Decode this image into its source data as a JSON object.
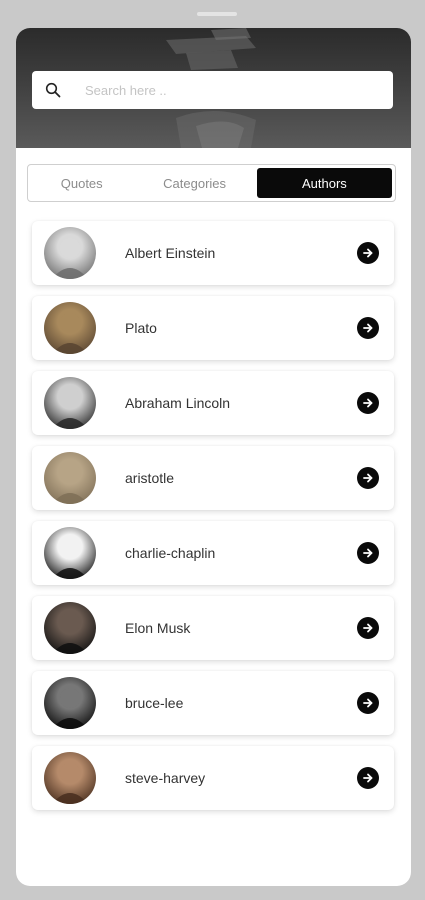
{
  "search": {
    "placeholder": "Search here ..",
    "icon": "search-icon"
  },
  "tabs": [
    {
      "label": "Quotes",
      "active": false
    },
    {
      "label": "Categories",
      "active": false
    },
    {
      "label": "Authors",
      "active": true
    }
  ],
  "authors": [
    {
      "name": "Albert Einstein",
      "avatar_colors": [
        "#d9d9d9",
        "#6f6f6f"
      ]
    },
    {
      "name": "Plato",
      "avatar_colors": [
        "#a8895c",
        "#5a4632"
      ]
    },
    {
      "name": "Abraham Lincoln",
      "avatar_colors": [
        "#cfcfcf",
        "#2a2a2a"
      ]
    },
    {
      "name": "aristotle",
      "avatar_colors": [
        "#b7a486",
        "#807058"
      ]
    },
    {
      "name": "charlie-chaplin",
      "avatar_colors": [
        "#f2f2f2",
        "#151515"
      ]
    },
    {
      "name": "Elon Musk",
      "avatar_colors": [
        "#6a5a50",
        "#111111"
      ]
    },
    {
      "name": "bruce-lee",
      "avatar_colors": [
        "#777777",
        "#0d0d0d"
      ]
    },
    {
      "name": "steve-harvey",
      "avatar_colors": [
        "#b58a6a",
        "#4a3020"
      ]
    }
  ],
  "colors": {
    "accent": "#0a0a0a",
    "header": "#3a3a3a",
    "frame": "#c9c9c9"
  },
  "arrow_icon": "arrow-right-circle-icon"
}
